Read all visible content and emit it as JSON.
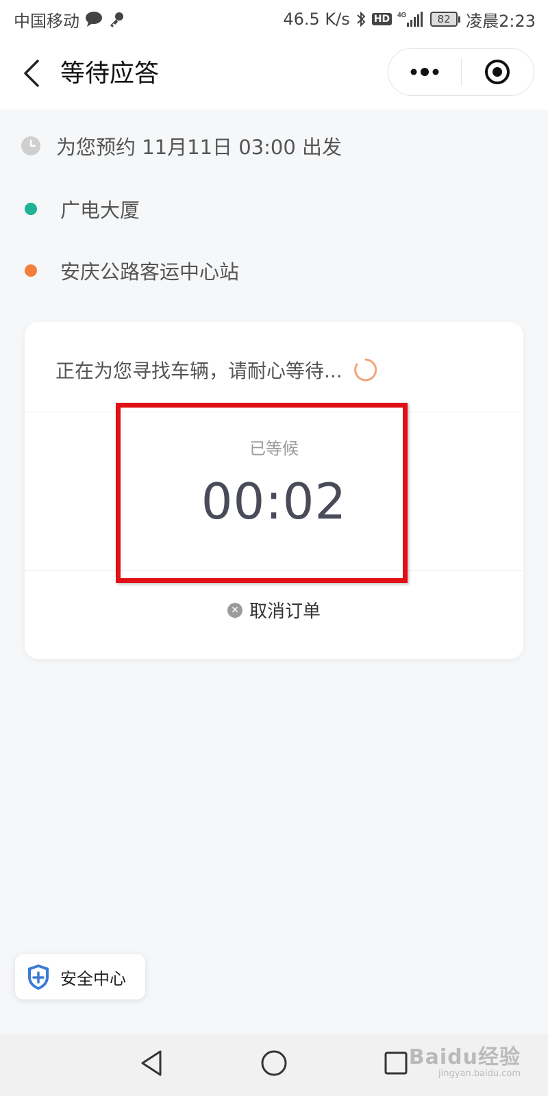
{
  "status_bar": {
    "carrier": "中国移动",
    "net_speed": "46.5 K/s",
    "hd": "HD",
    "signal": "4G",
    "battery": "82",
    "time": "凌晨2:23"
  },
  "nav": {
    "title": "等待应答"
  },
  "trip": {
    "schedule": "为您预约 11月11日 03:00 出发",
    "origin": "广电大厦",
    "destination": "安庆公路客运中心站"
  },
  "card": {
    "searching_text": "正在为您寻找车辆，请耐心等待...",
    "wait_label": "已等候",
    "wait_time": "00:02",
    "cancel_label": "取消订单"
  },
  "safety": {
    "label": "安全中心"
  },
  "watermark": {
    "main": "Baidu经验",
    "sub": "jingyan.baidu.com"
  },
  "colors": {
    "origin_dot": "#1db394",
    "destination_dot": "#f47e3d",
    "highlight": "#e01016",
    "spinner": "#f5a37a",
    "shield": "#3a7bd5"
  }
}
